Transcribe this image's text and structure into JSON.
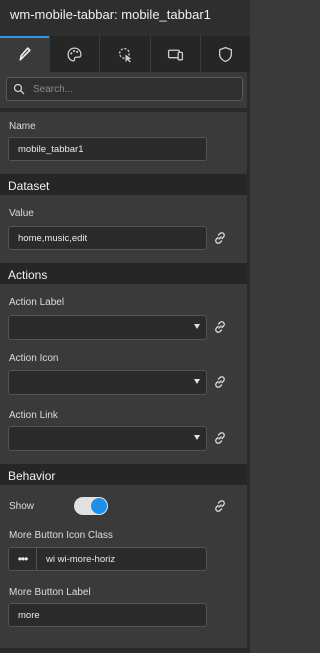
{
  "header": {
    "title": "wm-mobile-tabbar: mobile_tabbar1"
  },
  "tabs": [
    {
      "icon": "pencil-icon"
    },
    {
      "icon": "palette-icon"
    },
    {
      "icon": "cursor-click-icon"
    },
    {
      "icon": "devices-icon"
    },
    {
      "icon": "shield-icon"
    }
  ],
  "search": {
    "placeholder": "Search..."
  },
  "name": {
    "label": "Name",
    "value": "mobile_tabbar1"
  },
  "dataset": {
    "title": "Dataset",
    "value_label": "Value",
    "value": "home,music,edit"
  },
  "actions": {
    "title": "Actions",
    "action_label": "Action Label",
    "action_icon": "Action Icon",
    "action_link": "Action Link"
  },
  "behavior": {
    "title": "Behavior",
    "show_label": "Show",
    "show_on": true,
    "more_icon_label": "More Button Icon Class",
    "more_icon_btn": "•••",
    "more_icon_value": "wi wi-more-horiz",
    "more_label_label": "More Button Label",
    "more_label_value": "more"
  },
  "colors": {
    "accent": "#2f9be6",
    "toggle_knob": "#1e8fe8"
  }
}
